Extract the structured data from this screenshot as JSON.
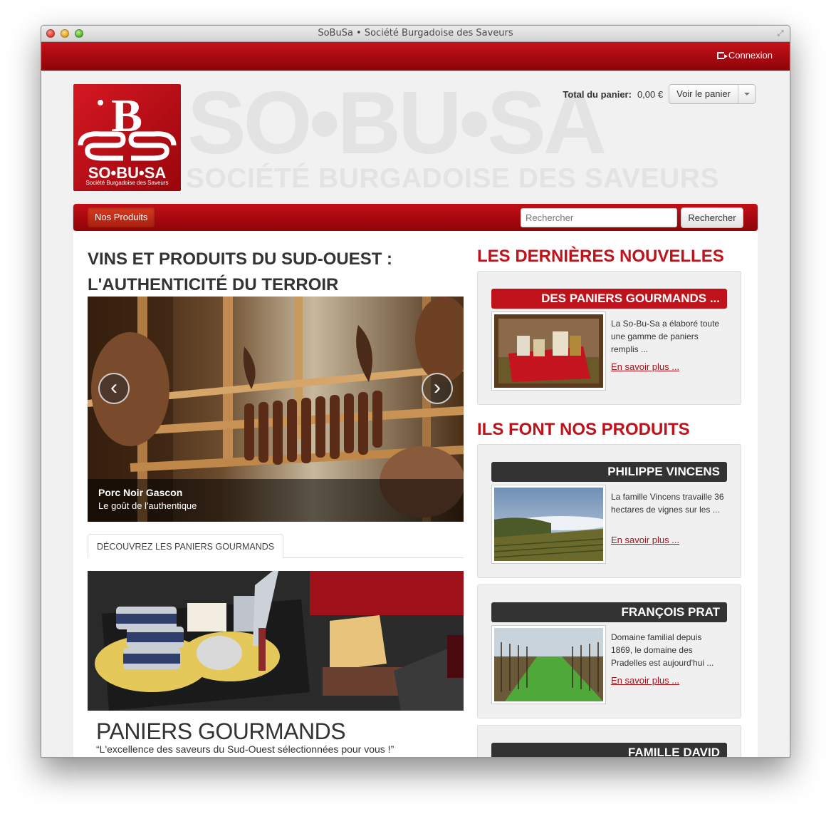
{
  "window": {
    "title": "SoBuSa • Société Burgadoise des Saveurs"
  },
  "topbar": {
    "login_label": "Connexion"
  },
  "logo": {
    "name": "SO•BU•SA",
    "tagline": "Société Burgadoise des Saveurs"
  },
  "banner": {
    "big": "SO•BU•SA",
    "sub": "SOCIÉTÉ BURGADOISE DES SAVEURS"
  },
  "cart": {
    "label": "Total du panier:",
    "total": "0,00 €",
    "button_label": "Voir le panier"
  },
  "nav": {
    "products_label": "Nos Produits",
    "search_placeholder": "Rechercher",
    "search_button": "Rechercher"
  },
  "main": {
    "title_line1": "VINS ET PRODUITS DU SUD-OUEST :",
    "title_line2": "L'AUTHENTICITÉ DU TERROIR",
    "slide": {
      "title": "Porc Noir Gascon",
      "subtitle": "Le goût de l'authentique",
      "prev": "‹",
      "next": "›"
    },
    "tab_label": "DÉCOUVREZ LES PANIERS GOURMANDS",
    "promo": {
      "title": "PANIERS GOURMANDS",
      "subtitle": "“L'excellence des saveurs du Sud-Ouest sélectionnées pour vous !”"
    }
  },
  "news": {
    "section_title": "LES DERNIÈRES NOUVELLES",
    "items": [
      {
        "heading": "DES PANIERS GOURMANDS ...",
        "text": "La So-Bu-Sa a élaboré toute une gamme de paniers remplis ...",
        "link": "En savoir plus ..."
      }
    ]
  },
  "producers": {
    "section_title": "ILS FONT NOS PRODUITS",
    "items": [
      {
        "heading": "PHILIPPE VINCENS",
        "text": "La famille Vincens travaille 36 hectares de vignes sur les ...",
        "link": "En savoir plus ..."
      },
      {
        "heading": "FRANÇOIS PRAT",
        "text": "Domaine familial depuis 1869, le domaine des Pradelles est aujourd'hui ...",
        "link": "En savoir plus ..."
      },
      {
        "heading": "FAMILLE DAVID"
      }
    ]
  },
  "colors": {
    "brand_red": "#c0121b",
    "dark_header": "#333333"
  }
}
